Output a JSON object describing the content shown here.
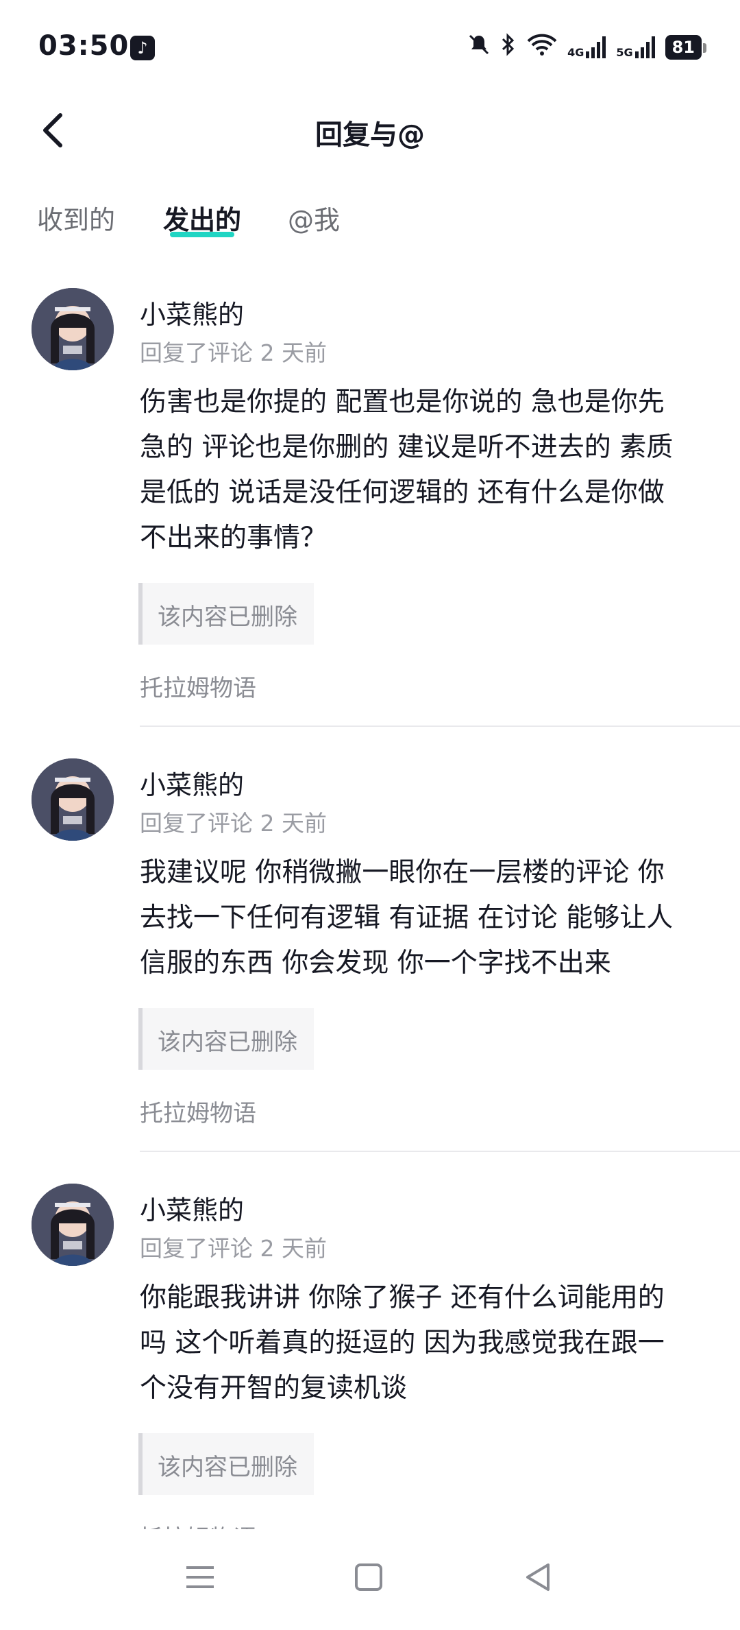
{
  "status_bar": {
    "time": "03:50",
    "battery": "81",
    "network_1": "4G",
    "network_2": "5G"
  },
  "header": {
    "title": "回复与@"
  },
  "tabs": [
    {
      "label": "收到的"
    },
    {
      "label": "发出的"
    },
    {
      "label": "@我"
    }
  ],
  "comments": [
    {
      "username": "小菜熊的",
      "meta": "回复了评论 2 天前",
      "text_lines": [
        "伤害也是你提的 配置也是你说的 急也是你先",
        "急的 评论也是你删的 建议是听不进去的 素质",
        "是低的 说话是没任何逻辑的 还有什么是你做",
        "不出来的事情？"
      ],
      "quote": "该内容已删除",
      "source": "托拉姆物语"
    },
    {
      "username": "小菜熊的",
      "meta": "回复了评论 2 天前",
      "text_lines": [
        "我建议呢 你稍微撇一眼你在一层楼的评论 你",
        "去找一下任何有逻辑 有证据 在讨论 能够让人",
        "信服的东西 你会发现 你一个字找不出来"
      ],
      "quote": "该内容已删除",
      "source": "托拉姆物语"
    },
    {
      "username": "小菜熊的",
      "meta": "回复了评论 2 天前",
      "text_lines": [
        "你能跟我讲讲 你除了猴子 还有什么词能用的",
        "吗 这个听着真的挺逗的 因为我感觉我在跟一",
        "个没有开智的复读机谈"
      ],
      "quote": "该内容已删除",
      "source": "托拉姆物语"
    }
  ],
  "colors": {
    "accent": "#20d5c3",
    "text": "#161823",
    "muted": "#9a9ca3"
  }
}
